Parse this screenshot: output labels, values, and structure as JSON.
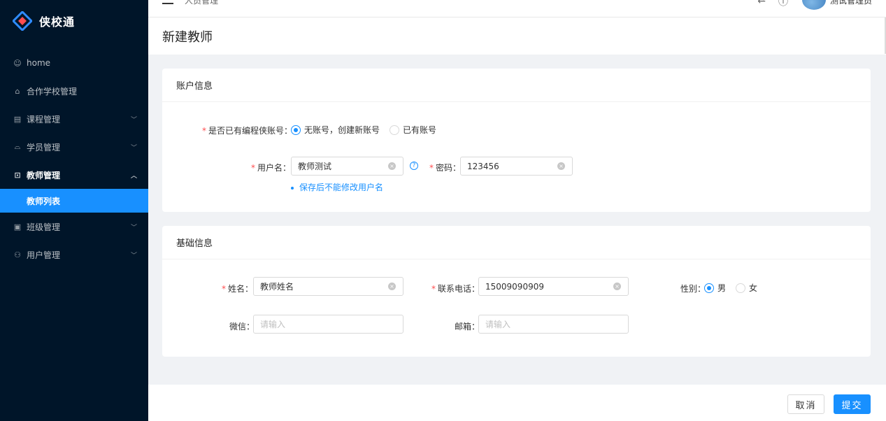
{
  "app": {
    "name": "侠校通"
  },
  "sidebar": {
    "items": [
      {
        "label": "home",
        "icon": "smile-icon",
        "has_children": false
      },
      {
        "label": "合作学校管理",
        "icon": "bank-icon",
        "has_children": false
      },
      {
        "label": "课程管理",
        "icon": "book-icon",
        "has_children": true
      },
      {
        "label": "学员管理",
        "icon": "student-icon",
        "has_children": true
      },
      {
        "label": "教师管理",
        "icon": "teacher-icon",
        "has_children": true,
        "open": true
      },
      {
        "label": "班级管理",
        "icon": "class-icon",
        "has_children": true
      },
      {
        "label": "用户管理",
        "icon": "users-icon",
        "has_children": true
      }
    ],
    "active_sub": "教师列表"
  },
  "header": {
    "breadcrumb": "人员管理",
    "user_name": "测试管理员"
  },
  "page": {
    "title": "新建教师"
  },
  "account_section": {
    "title": "账户信息",
    "has_account_label": "是否已有编程侠账号",
    "options": [
      "无账号，创建新账号",
      "已有账号"
    ],
    "selected_index": 0,
    "username_label": "用户名",
    "username_value": "教师测试",
    "password_label": "密码",
    "password_value": "123456",
    "hint": "保存后不能修改用户名"
  },
  "basic_section": {
    "title": "基础信息",
    "name_label": "姓名",
    "name_value": "教师姓名",
    "phone_label": "联系电话",
    "phone_value": "15009090909",
    "gender_label": "性别",
    "gender_options": [
      "男",
      "女"
    ],
    "gender_selected": 0,
    "wechat_label": "微信",
    "wechat_placeholder": "请输入",
    "email_label": "邮箱",
    "email_placeholder": "请输入"
  },
  "footer": {
    "cancel": "取消",
    "submit": "提交"
  },
  "colors": {
    "primary": "#1890ff",
    "sidebar_bg": "#001529",
    "required": "#ff4d4f"
  }
}
